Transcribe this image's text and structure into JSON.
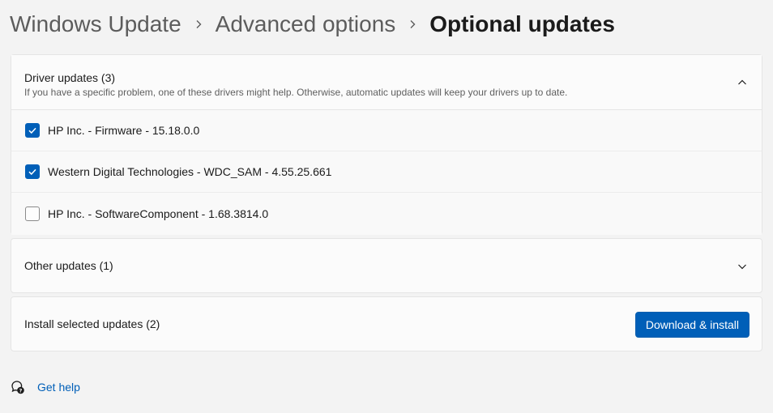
{
  "breadcrumb": {
    "items": [
      "Windows Update",
      "Advanced options",
      "Optional updates"
    ]
  },
  "driver_updates": {
    "title": "Driver updates (3)",
    "description": "If you have a specific problem, one of these drivers might help. Otherwise, automatic updates will keep your drivers up to date.",
    "expanded": true,
    "items": [
      {
        "label": "HP Inc. - Firmware - 15.18.0.0",
        "checked": true
      },
      {
        "label": "Western Digital Technologies - WDC_SAM - 4.55.25.661",
        "checked": true
      },
      {
        "label": "HP Inc. - SoftwareComponent - 1.68.3814.0",
        "checked": false
      }
    ]
  },
  "other_updates": {
    "title": "Other updates (1)",
    "expanded": false
  },
  "install": {
    "label": "Install selected updates (2)",
    "button_label": "Download & install"
  },
  "help": {
    "label": "Get help",
    "icon": "help-chat-icon"
  },
  "colors": {
    "accent": "#005fb8",
    "background": "#f3f3f3",
    "card": "#fbfbfb"
  }
}
